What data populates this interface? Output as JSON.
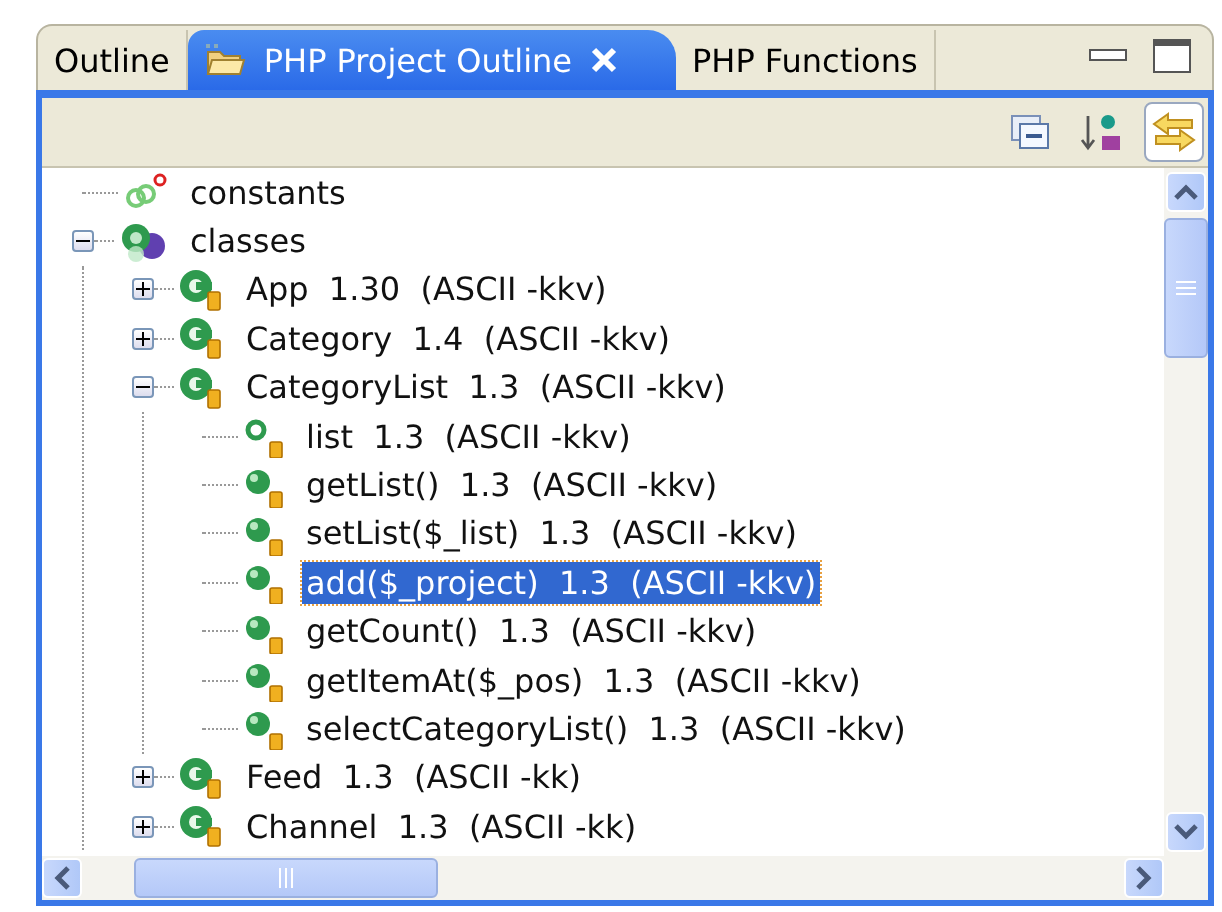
{
  "tabs": [
    {
      "label": "Outline",
      "selected": false,
      "closable": false
    },
    {
      "label": "PHP Project Outline",
      "selected": true,
      "closable": true
    },
    {
      "label": "PHP Functions",
      "selected": false,
      "closable": false
    }
  ],
  "toolbar": [
    {
      "kind": "collapse",
      "pressed": false
    },
    {
      "kind": "sort",
      "pressed": false
    },
    {
      "kind": "link",
      "pressed": true
    }
  ],
  "tree": [
    {
      "label": "constants",
      "kind": "constants",
      "selected": false
    },
    {
      "label": "classes",
      "kind": "classes",
      "selected": false,
      "expanded": true,
      "children": [
        {
          "label": "App  1.30  (ASCII -kkv)",
          "kind": "class",
          "selected": false,
          "expanded": false
        },
        {
          "label": "Category  1.4  (ASCII -kkv)",
          "kind": "class",
          "selected": false,
          "expanded": false
        },
        {
          "label": "CategoryList  1.3  (ASCII -kkv)",
          "kind": "class",
          "selected": false,
          "expanded": true,
          "children": [
            {
              "label": "list  1.3  (ASCII -kkv)",
              "kind": "field",
              "selected": false
            },
            {
              "label": "getList()  1.3  (ASCII -kkv)",
              "kind": "method",
              "selected": false
            },
            {
              "label": "setList($_list)  1.3  (ASCII -kkv)",
              "kind": "method",
              "selected": false
            },
            {
              "label": "add($_project)  1.3  (ASCII -kkv)",
              "kind": "method",
              "selected": true
            },
            {
              "label": "getCount()  1.3  (ASCII -kkv)",
              "kind": "method",
              "selected": false
            },
            {
              "label": "getItemAt($_pos)  1.3  (ASCII -kkv)",
              "kind": "method",
              "selected": false
            },
            {
              "label": "selectCategoryList()  1.3  (ASCII -kkv)",
              "kind": "method",
              "selected": false
            }
          ]
        },
        {
          "label": "Feed  1.3  (ASCII -kk)",
          "kind": "class",
          "selected": false,
          "expanded": false
        },
        {
          "label": "Channel  1.3  (ASCII -kk)",
          "kind": "class",
          "selected": false,
          "expanded": false
        }
      ]
    }
  ]
}
